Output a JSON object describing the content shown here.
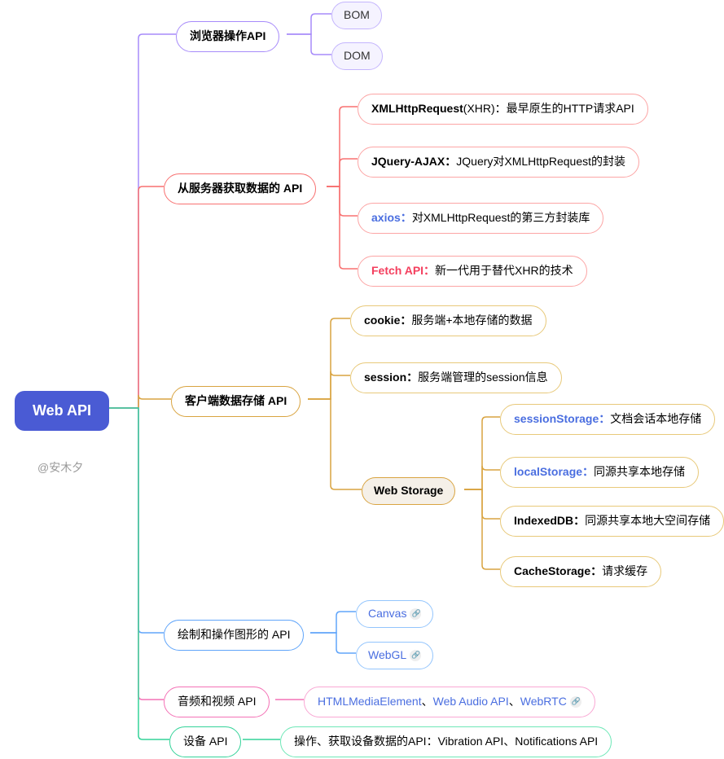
{
  "root": {
    "label": "Web API"
  },
  "watermark": "@安木夕",
  "branches": {
    "browser": {
      "label": "浏览器操作API",
      "leaves": {
        "bom": "BOM",
        "dom": "DOM"
      }
    },
    "server": {
      "label": "从服务器获取数据的 API",
      "leaves": {
        "xhr": {
          "key": "XMLHttpRequest",
          "paren": "(XHR)：",
          "desc": "最早原生的HTTP请求API"
        },
        "jq": {
          "key": "JQuery-AJAX：",
          "desc": "JQuery对XMLHttpRequest的封装"
        },
        "axios": {
          "key": "axios：",
          "desc": "对XMLHttpRequest的第三方封装库"
        },
        "fetch": {
          "key": "Fetch API：",
          "desc": "新一代用于替代XHR的技术"
        }
      }
    },
    "client": {
      "label": "客户端数据存储 API",
      "leaves": {
        "cookie": {
          "key": "cookie：",
          "desc": "服务端+本地存储的数据"
        },
        "session": {
          "key": "session：",
          "desc": "服务端管理的session信息"
        }
      },
      "webstorage": {
        "label": "Web Storage",
        "leaves": {
          "ss": {
            "key": "sessionStorage：",
            "desc": "文档会话本地存储"
          },
          "ls": {
            "key": "localStorage：",
            "desc": "同源共享本地存储"
          },
          "idb": {
            "key": "IndexedDB：",
            "desc": "同源共享本地大空间存储"
          },
          "cs": {
            "key": "CacheStorage：",
            "desc": "请求缓存"
          }
        }
      }
    },
    "graphics": {
      "label": "绘制和操作图形的 API",
      "leaves": {
        "canvas": "Canvas",
        "webgl": "WebGL"
      }
    },
    "media": {
      "label": "音频和视频 API",
      "leaf": {
        "a": "HTMLMediaElement",
        "sep1": "、",
        "b": "Web Audio API",
        "sep2": "、",
        "c": "WebRTC"
      }
    },
    "device": {
      "label": "设备 API",
      "leaf": "操作、获取设备数据的API：Vibration API、Notifications API"
    }
  },
  "colors": {
    "root": "#4a5bd4",
    "purple": "#a78bfa",
    "red": "#f87171",
    "amber": "#d9a441",
    "blue": "#60a5fa",
    "pink": "#f472b6",
    "green": "#34d399"
  }
}
